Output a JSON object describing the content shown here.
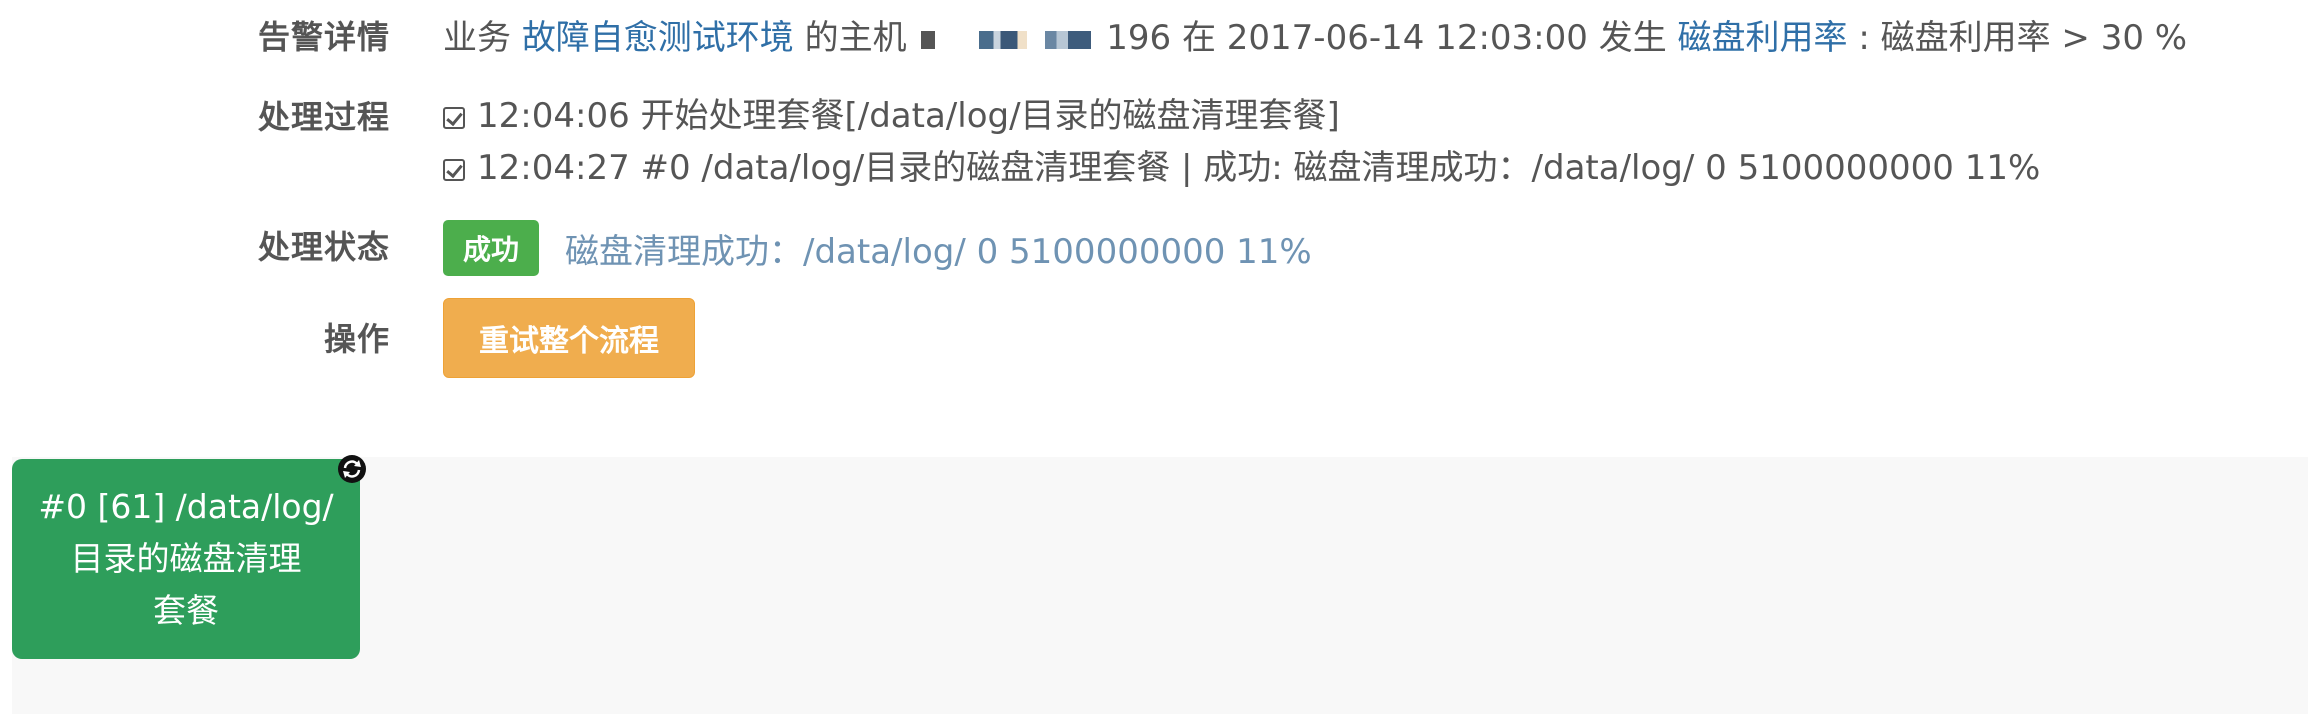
{
  "alert_detail": {
    "label": "告警详情",
    "text_business": "业务",
    "business_link": "故障自愈测试环境",
    "text_host": "的主机",
    "host_suffix": "196",
    "text_at": "在",
    "timestamp": "2017-06-14 12:03:00",
    "text_occurred": "发生",
    "metric_link": "磁盘利用率",
    "condition": ": 磁盘利用率 > 30 %"
  },
  "process": {
    "label": "处理过程",
    "steps": [
      {
        "text": "12:04:06 开始处理套餐[/data/log/目录的磁盘清理套餐]"
      },
      {
        "text": "12:04:27 #0 /data/log/目录的磁盘清理套餐 | 成功: 磁盘清理成功：/data/log/ 0 5100000000 11%"
      }
    ]
  },
  "status": {
    "label": "处理状态",
    "badge": "成功",
    "message": "磁盘清理成功：/data/log/ 0 5100000000 11%"
  },
  "actions": {
    "label": "操作",
    "retry_button": "重试整个流程"
  },
  "flow": {
    "node_text": "#0 [61] /data/log/\n目录的磁盘清理\n套餐",
    "node_icon": "refresh-icon",
    "node_color": "#2e9e5b"
  },
  "colors": {
    "link": "#2f6fa7",
    "success": "#4cae4c",
    "warning": "#f0ad4e"
  }
}
